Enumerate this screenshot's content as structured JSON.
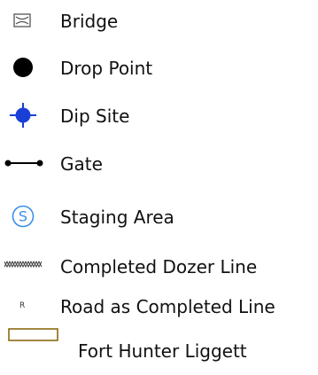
{
  "legend": {
    "items": [
      {
        "icon": "bridge-icon",
        "label": "Bridge"
      },
      {
        "icon": "drop-point-icon",
        "label": "Drop Point"
      },
      {
        "icon": "dip-site-icon",
        "label": "Dip Site",
        "color": "#1a3fd6"
      },
      {
        "icon": "gate-icon",
        "label": "Gate"
      },
      {
        "icon": "staging-area-icon",
        "label": "Staging Area",
        "color": "#3b8ee8"
      },
      {
        "icon": "completed-dozer-line-icon",
        "label": "Completed Dozer Line"
      },
      {
        "icon": "road-as-completed-line-icon",
        "label": "Road as Completed Line",
        "symbol_text": "R"
      },
      {
        "icon": "fort-hunter-liggett-icon",
        "label": "Fort Hunter Liggett",
        "color": "#8a6a12"
      }
    ]
  }
}
